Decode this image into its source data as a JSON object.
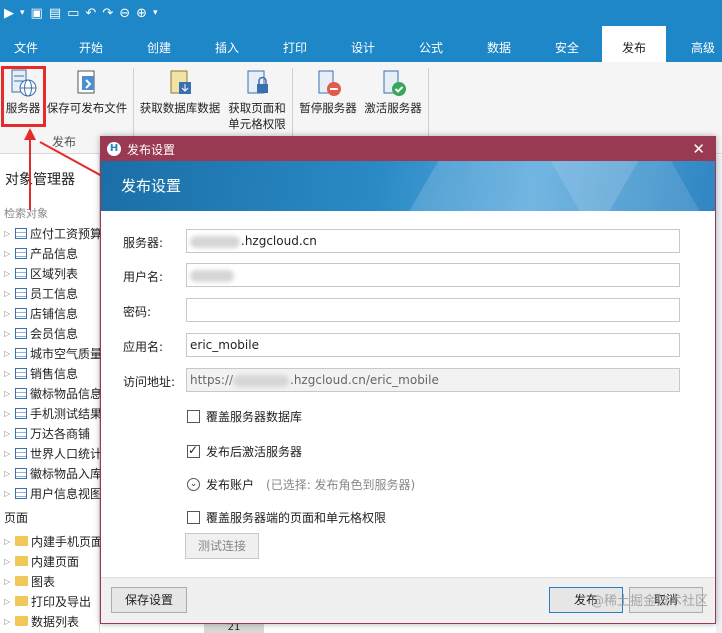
{
  "quick_access": [
    "▶",
    "▾",
    "▣",
    "▤",
    "▭",
    "↶",
    "↷",
    "⊖",
    "⊕",
    "▾"
  ],
  "tabs": [
    "文件",
    "开始",
    "创建",
    "插入",
    "打印",
    "设计",
    "公式",
    "数据",
    "安全",
    "发布",
    "高级"
  ],
  "active_tab": "发布",
  "ribbon": {
    "buttons": [
      {
        "label": "服务器"
      },
      {
        "label": "保存可发布文件"
      },
      {
        "label": "获取数据库数据"
      },
      {
        "label_line1": "获取页面和",
        "label_line2": "单元格权限"
      },
      {
        "label": "暂停服务器"
      },
      {
        "label": "激活服务器"
      }
    ],
    "group_label": "发布"
  },
  "left_panel": {
    "title": "对象管理器",
    "search_placeholder": "检索对象",
    "tables": [
      "应付工资预算",
      "产品信息",
      "区域列表",
      "员工信息",
      "店铺信息",
      "会员信息",
      "城市空气质量",
      "销售信息",
      "徽标物品信息",
      "手机测试结果",
      "万达各商铺",
      "世界人口统计",
      "徽标物品入库"
    ],
    "view": "用户信息视图",
    "pages_label": "页面",
    "pages": [
      "内建手机页面",
      "内建页面",
      "图表",
      "打印及导出",
      "数据列表"
    ]
  },
  "bottom_row_number": "21",
  "dialog": {
    "title": "发布设置",
    "heading": "发布设置",
    "fields": {
      "server_label": "服务器:",
      "server_value": ".hzgcloud.cn",
      "username_label": "用户名:",
      "username_value": "",
      "password_label": "密码:",
      "password_value": "",
      "app_label": "应用名:",
      "app_value": "eric_mobile",
      "url_label": "访问地址:",
      "url_prefix": "https://",
      "url_suffix": ".hzgcloud.cn/eric_mobile"
    },
    "options": {
      "overwrite_db": "覆盖服务器数据库",
      "overwrite_db_checked": false,
      "activate_after": "发布后激活服务器",
      "activate_after_checked": true,
      "publish_account": "发布账户",
      "publish_account_hint": "(已选择: 发布角色到服务器)",
      "overwrite_perms": "覆盖服务器端的页面和单元格权限",
      "overwrite_perms_checked": false
    },
    "test_button": "测试连接",
    "save_button": "保存设置",
    "publish_button": "发布",
    "cancel_button": "取消"
  },
  "watermark": "@稀土掘金技术社区",
  "colors": {
    "accent": "#1e87c8",
    "dialog_title": "#9a3a52",
    "highlight": "#e52b2b"
  }
}
